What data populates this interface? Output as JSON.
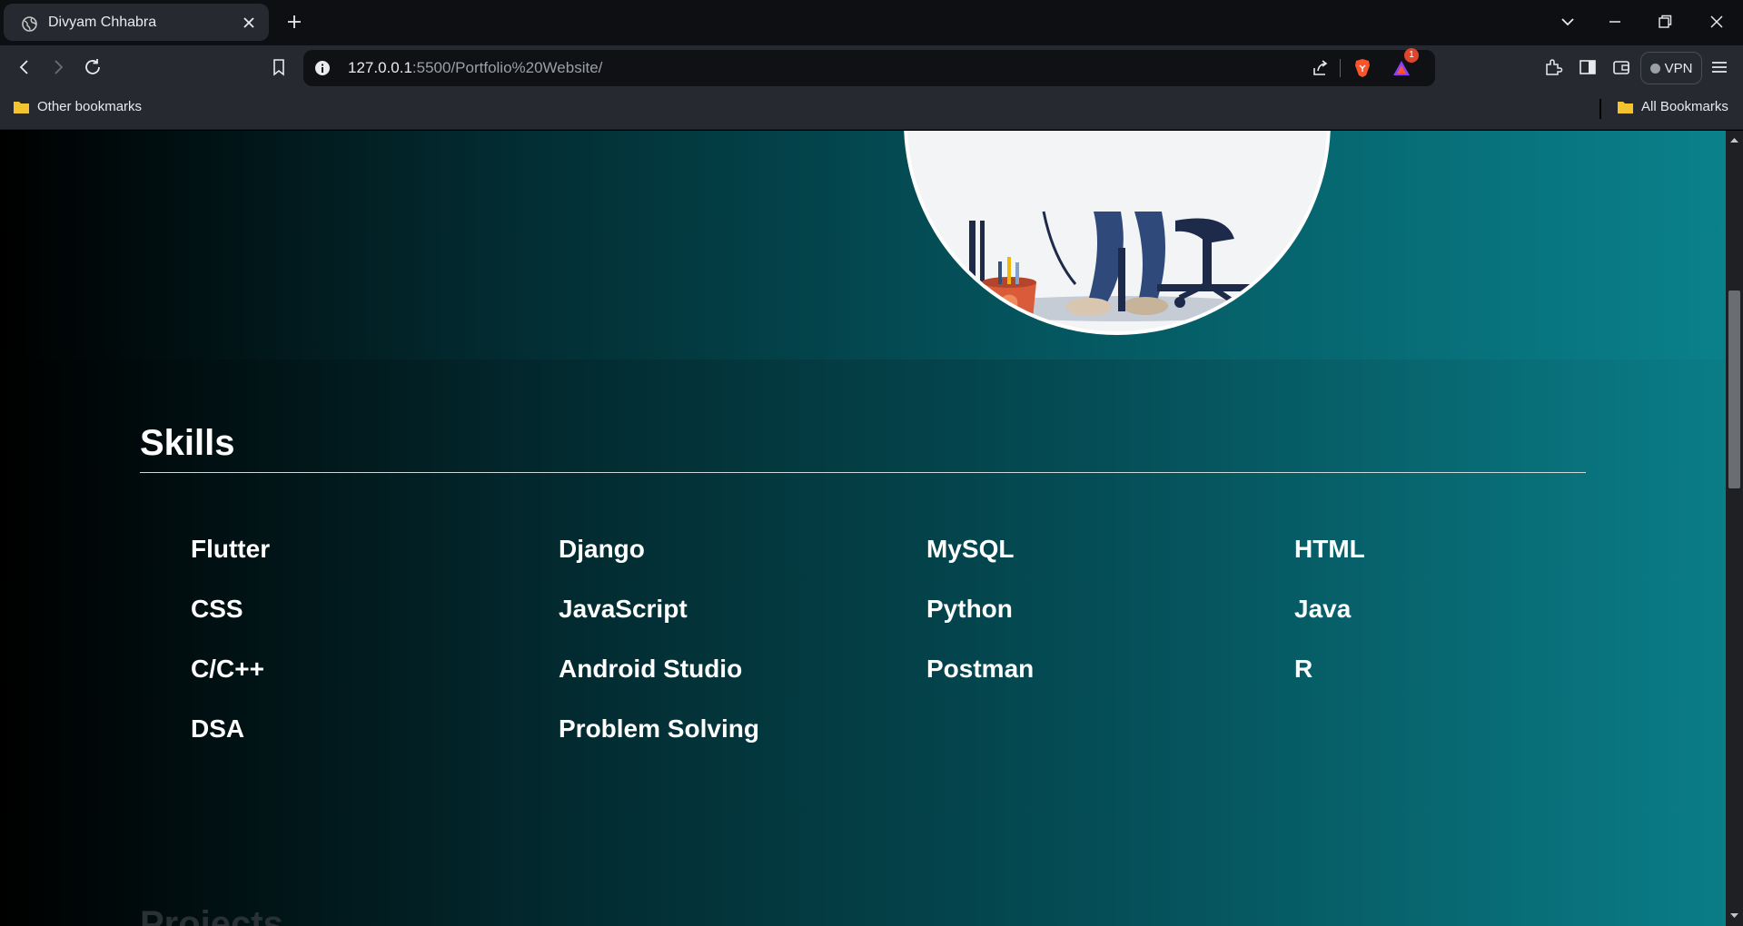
{
  "tab": {
    "title": "Divyam Chhabra"
  },
  "address_bar": {
    "host": "127.0.0.1",
    "path": ":5500/Portfolio%20Website/"
  },
  "toolbar": {
    "vpn_label": "VPN",
    "notification_count": "1"
  },
  "bookmarks": {
    "left": "Other bookmarks",
    "right": "All Bookmarks"
  },
  "skills": {
    "title": "Skills",
    "items": [
      "Flutter",
      "Django",
      "MySQL",
      "HTML",
      "CSS",
      "JavaScript",
      "Python",
      "Java",
      "C/C++",
      "Android Studio",
      "Postman",
      "R",
      "DSA",
      "Problem Solving"
    ]
  },
  "next_section": {
    "title": "Projects"
  },
  "colors": {
    "accent": "#0a7d87",
    "background": "#000000"
  }
}
